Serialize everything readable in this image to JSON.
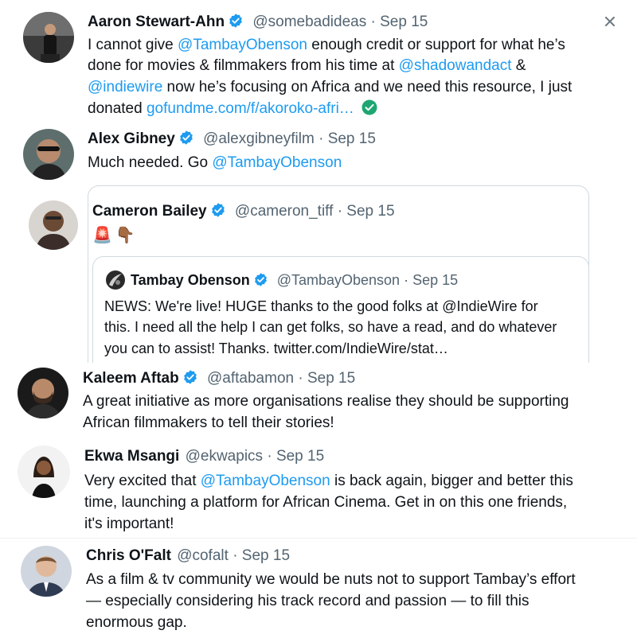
{
  "colors": {
    "link": "#1d9bf0",
    "muted": "#536471",
    "verified": "#1d9bf0",
    "check": "#1ea672"
  },
  "tweets": [
    {
      "name": "Aaron Stewart-Ahn",
      "handle": "@somebadideas",
      "dot": "·",
      "date": "Sep 15",
      "body": {
        "l1a": "I cannot give ",
        "l1b": "@TambayObenson",
        "l1c": " enough credit or support for what he’s",
        "l2a": "done for movies & filmmakers from his time at ",
        "l2b": "@shadowandact",
        "l2c": " &",
        "l3a": "@indiewire",
        "l3b": " now he’s focusing on Africa and we need this resource, I just",
        "l4a": "donated ",
        "l4b": "gofundme.com/f/akoroko-afri…"
      },
      "trailing_icon": "check-circle-icon"
    },
    {
      "name": "Alex Gibney",
      "handle": "@alexgibneyfilm",
      "dot": "·",
      "date": "Sep 15",
      "body": {
        "l1a": "Much needed. Go ",
        "l1b": "@TambayObenson"
      }
    },
    {
      "name": "Cameron Bailey",
      "handle": "@cameron_tiff",
      "dot": "·",
      "date": "Sep 15",
      "emoji": [
        "🚨",
        "👇🏾"
      ],
      "quote": {
        "name": "Tambay Obenson",
        "handle": "@TambayObenson",
        "dot": "·",
        "date": "Sep 15",
        "l1": "NEWS: We're live! HUGE thanks to the good folks at @IndieWire for",
        "l2": "this. I need all the help I can get folks, so have a read, and do whatever",
        "l3": "you can to assist! Thanks. twitter.com/IndieWire/stat…"
      }
    },
    {
      "name": "Kaleem Aftab",
      "handle": "@aftabamon",
      "dot": "·",
      "date": "Sep 15",
      "body": {
        "l1": "A great initiative as more organisations realise they should be supporting",
        "l2": "African filmmakers to tell their stories!"
      }
    },
    {
      "name": "Ekwa Msangi",
      "handle": "@ekwapics",
      "dot": "·",
      "date": "Sep 15",
      "body": {
        "l1a": "Very excited that ",
        "l1b": "@TambayObenson",
        "l1c": " is back again, bigger and better this",
        "l2": "time, launching a platform for African Cinema. Get in on this one friends,",
        "l3": "it's important!"
      }
    },
    {
      "name": "Chris O'Falt",
      "handle": "@cofalt",
      "dot": "·",
      "date": "Sep 15",
      "body": {
        "l1": "As a film & tv community we would be nuts not to support Tambay’s effort",
        "l2": "— especially considering his track record and passion — to fill this",
        "l3": "enormous gap."
      }
    }
  ]
}
